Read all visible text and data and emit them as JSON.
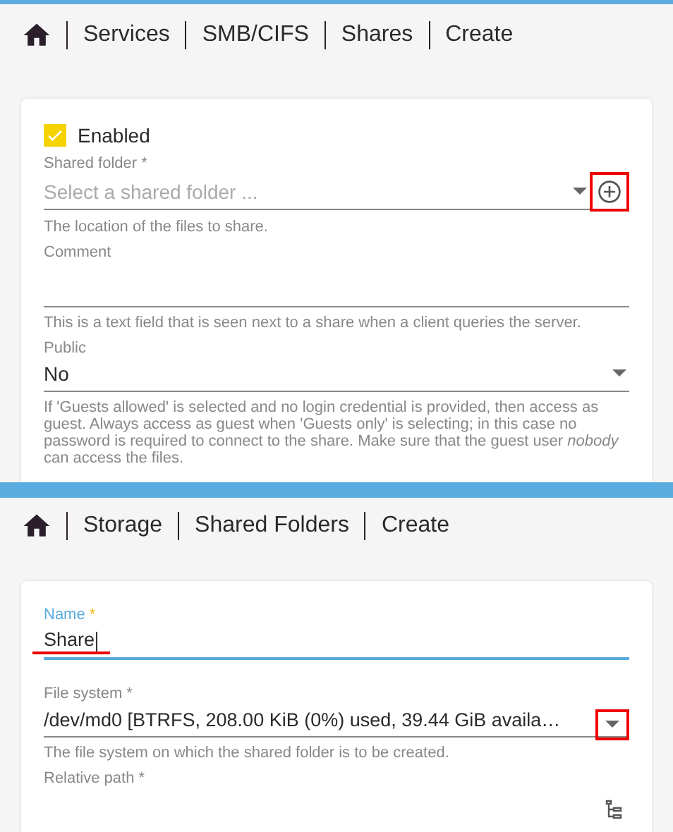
{
  "panels": [
    {
      "breadcrumb": [
        "Services",
        "SMB/CIFS",
        "Shares",
        "Create"
      ],
      "fields": [
        {
          "kind": "checkbox",
          "label": "Enabled",
          "checked": true
        },
        {
          "kind": "select",
          "label": "Shared folder *",
          "placeholder": "Select a shared folder ...",
          "hint": "The location of the files to share.",
          "add_button": true,
          "annotated": true
        },
        {
          "kind": "text",
          "label": "Comment",
          "hint": "This is a text field that is seen next to a share when a client queries the server."
        },
        {
          "kind": "select",
          "label": "Public",
          "value": "No",
          "hint": "If 'Guests allowed' is selected and no login credential is provided, then access as guest. Always access as guest when 'Guests only' is selecting; in this case no password is required to connect to the share. Make sure that the guest user *nobody* can access the files."
        }
      ]
    },
    {
      "breadcrumb": [
        "Storage",
        "Shared Folders",
        "Create"
      ],
      "fields": [
        {
          "kind": "text",
          "label": "Name",
          "required": "*",
          "value": "Share",
          "focused": true,
          "underlined": true
        },
        {
          "kind": "select",
          "label": "File system *",
          "value": "/dev/md0 [BTRFS, 208.00 KiB (0%) used, 39.44 GiB availa…",
          "hint": "The file system on which the shared folder is to be created.",
          "caret_annotated": true
        },
        {
          "kind": "text",
          "label": "Relative path *",
          "tree_button": true
        }
      ]
    }
  ]
}
